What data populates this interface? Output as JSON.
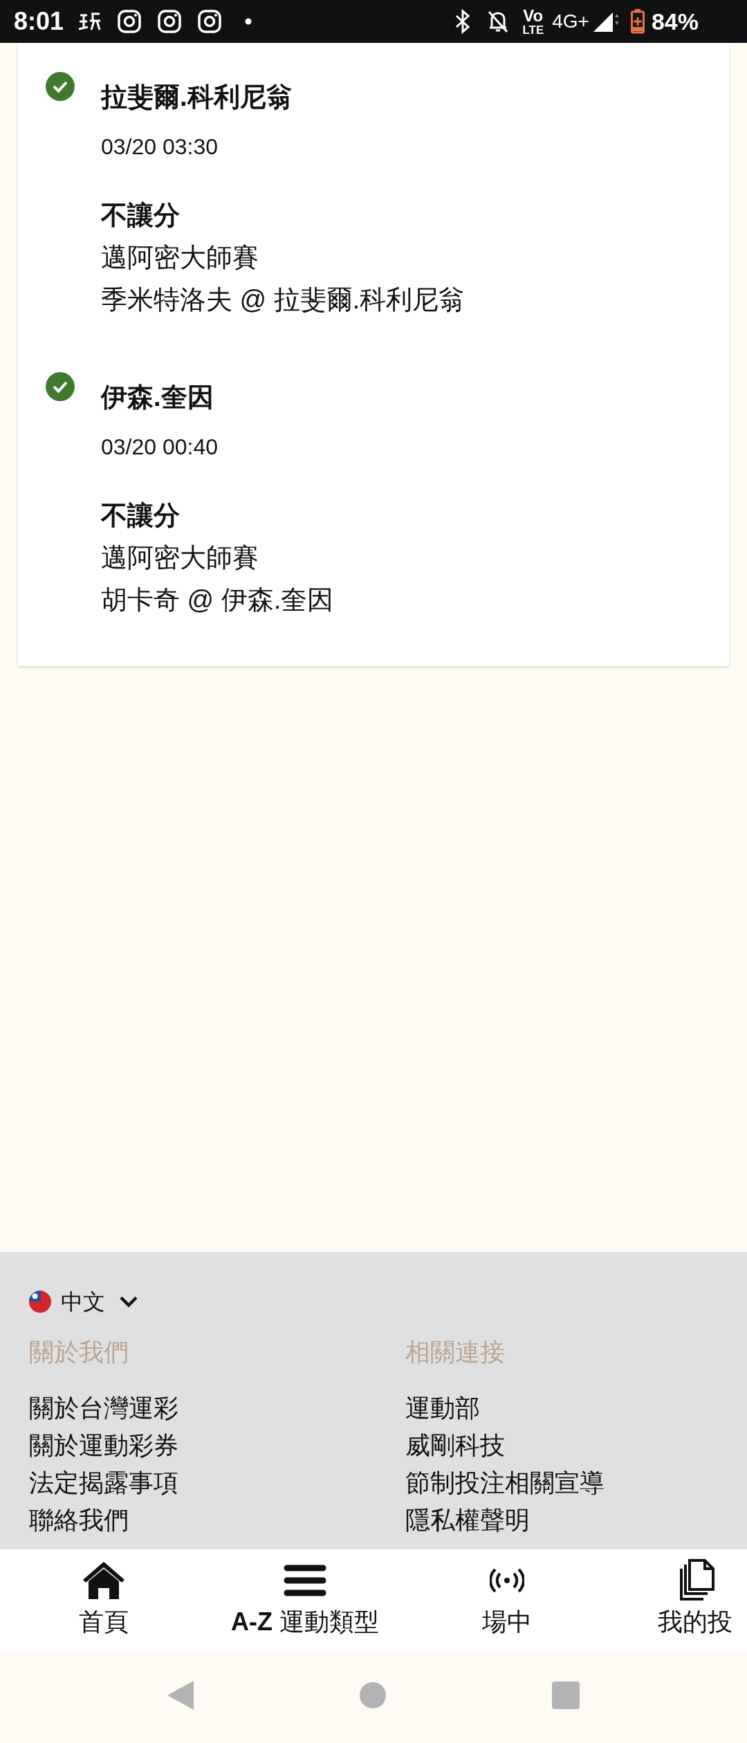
{
  "status_bar": {
    "time": "8:01",
    "volte": [
      "Vo",
      "LTE"
    ],
    "network": "4G+",
    "battery": "84%"
  },
  "bets": [
    {
      "settled": true,
      "selection": "拉斐爾.科利尼翁",
      "time": "03/20 03:30",
      "market": "不讓分",
      "event": "邁阿密大師賽",
      "match": "季米特洛夫 @ 拉斐爾.科利尼翁"
    },
    {
      "settled": true,
      "selection": "伊森.奎因",
      "time": "03/20 00:40",
      "market": "不讓分",
      "event": "邁阿密大師賽",
      "match": "胡卡奇 @ 伊森.奎因"
    }
  ],
  "footer": {
    "language": "中文",
    "columns": [
      {
        "heading": "關於我們",
        "links": [
          "關於台灣運彩",
          "關於運動彩券",
          "法定揭露事項",
          "聯絡我們"
        ]
      },
      {
        "heading": "相關連接",
        "links": [
          "運動部",
          "威剛科技",
          "節制投注相關宣導",
          "隱私權聲明"
        ]
      }
    ]
  },
  "bottom_nav": [
    {
      "kind": "home",
      "label": "首頁"
    },
    {
      "kind": "menu",
      "label": "A-Z 運動類型"
    },
    {
      "kind": "live",
      "label": "場中"
    },
    {
      "kind": "bets",
      "label": "我的投"
    }
  ]
}
